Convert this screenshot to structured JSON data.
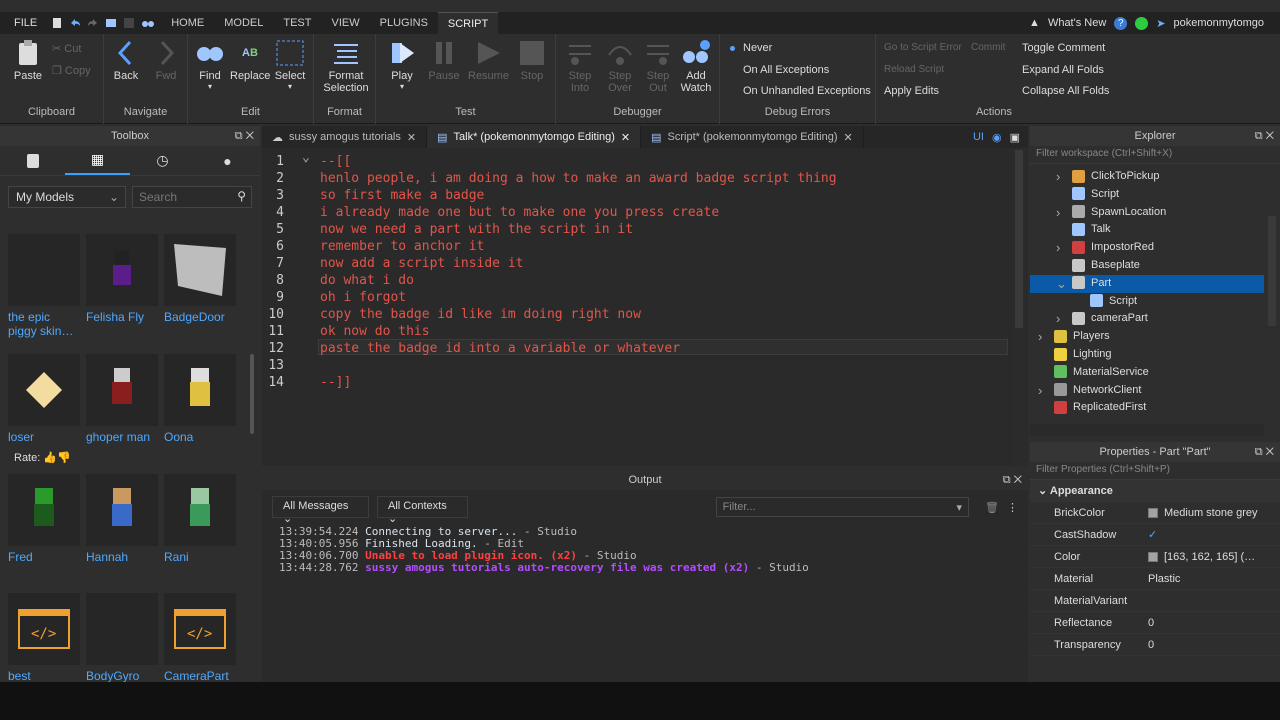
{
  "menubar": {
    "file": "FILE",
    "tabs": [
      "HOME",
      "MODEL",
      "TEST",
      "VIEW",
      "PLUGINS",
      "SCRIPT"
    ],
    "active_tab": "SCRIPT",
    "whats_new": "What's New",
    "username": "pokemonmytomgo"
  },
  "ribbon": {
    "clipboard": {
      "label": "Clipboard",
      "paste": "Paste",
      "cut": "Cut",
      "copy": "Copy"
    },
    "navigate": {
      "label": "Navigate",
      "back": "Back",
      "fwd": "Fwd"
    },
    "edit": {
      "label": "Edit",
      "find": "Find",
      "replace": "Replace",
      "select": "Select"
    },
    "format": {
      "label": "Format",
      "format_selection": "Format Selection"
    },
    "test": {
      "label": "Test",
      "play": "Play",
      "pause": "Pause",
      "resume": "Resume",
      "stop": "Stop"
    },
    "debugger": {
      "label": "Debugger",
      "step_into": "Step Into",
      "step_over": "Step Over",
      "step_out": "Step Out",
      "add_watch": "Add Watch"
    },
    "debug_errors": {
      "label": "Debug Errors",
      "never": "Never",
      "all": "On All Exceptions",
      "unhandled": "On Unhandled Exceptions"
    },
    "actions": {
      "label": "Actions",
      "go_to_error": "Go to Script Error",
      "commit": "Commit",
      "reload": "Reload Script",
      "apply": "Apply Edits",
      "toggle_comment": "Toggle Comment",
      "expand": "Expand All Folds",
      "collapse": "Collapse All Folds"
    }
  },
  "toolbox": {
    "title": "Toolbox",
    "dropdown": "My Models",
    "search_placeholder": "Search",
    "rate_label": "Rate:",
    "items": [
      "the epic piggy skin…",
      "Felisha Fly",
      "BadgeDoor",
      "loser",
      "ghoper man",
      "Oona",
      "Fred",
      "Hannah",
      "Rani",
      "best",
      "BodyGyro",
      "CameraPart"
    ]
  },
  "editor": {
    "tabs": [
      "sussy amogus tutorials",
      "Talk* (pokemonmytomgo Editing)",
      "Script* (pokemonmytomgo Editing)"
    ],
    "ui_label": "UI",
    "lines": [
      "--[[",
      "henlo people, i am doing a how to make an award badge script thing",
      "so first make a badge",
      "i already made one but to make one you press create",
      "now we need a part with the script in it",
      "remember to anchor it",
      "now add a script inside it",
      "do what i do",
      "oh i forgot",
      "copy the badge id like im doing right now",
      "ok now do this",
      "paste the badge id into a variable or whatever",
      "",
      "--]]"
    ],
    "current_line": 12
  },
  "output": {
    "title": "Output",
    "all_messages": "All Messages",
    "all_contexts": "All Contexts",
    "filter_placeholder": "Filter...",
    "logs": [
      {
        "time": "13:39:54.224",
        "msg": "Connecting to server...",
        "ctx": "  -  Studio",
        "color": "#d6e4f0"
      },
      {
        "time": "13:40:05.956",
        "msg": "Finished Loading.",
        "ctx": "  -  Edit",
        "color": "#d6e4f0"
      },
      {
        "time": "13:40:06.700",
        "msg": "Unable to load plugin icon. (x2)",
        "ctx": "  -  Studio",
        "color": "#ff4040"
      },
      {
        "time": "13:44:28.762",
        "msg": "sussy amogus tutorials auto-recovery file was created (x2)",
        "ctx": "  -  Studio",
        "color": "#b44cff"
      }
    ]
  },
  "explorer": {
    "title": "Explorer",
    "filter": "Filter workspace (Ctrl+Shift+X)",
    "nodes": [
      {
        "label": "ClickToPickup",
        "indent": 2,
        "arrow": "right",
        "color": "#e0a040"
      },
      {
        "label": "Script",
        "indent": 2,
        "arrow": "",
        "color": "#9fc6ff"
      },
      {
        "label": "SpawnLocation",
        "indent": 2,
        "arrow": "right",
        "color": "#aaaaaa"
      },
      {
        "label": "Talk",
        "indent": 2,
        "arrow": "",
        "color": "#9fc6ff"
      },
      {
        "label": "ImpostorRed",
        "indent": 2,
        "arrow": "right",
        "color": "#d04040"
      },
      {
        "label": "Baseplate",
        "indent": 2,
        "arrow": "",
        "color": "#c8c8c8"
      },
      {
        "label": "Part",
        "indent": 2,
        "arrow": "down",
        "color": "#c8c8c8",
        "selected": true
      },
      {
        "label": "Script",
        "indent": 3,
        "arrow": "",
        "color": "#9fc6ff"
      },
      {
        "label": "cameraPart",
        "indent": 2,
        "arrow": "right",
        "color": "#c8c8c8"
      },
      {
        "label": "Players",
        "indent": 1,
        "arrow": "right",
        "color": "#e0c040"
      },
      {
        "label": "Lighting",
        "indent": 1,
        "arrow": "",
        "color": "#f0d040"
      },
      {
        "label": "MaterialService",
        "indent": 1,
        "arrow": "",
        "color": "#60c060"
      },
      {
        "label": "NetworkClient",
        "indent": 1,
        "arrow": "right",
        "color": "#999999"
      },
      {
        "label": "ReplicatedFirst",
        "indent": 1,
        "arrow": "",
        "color": "#d04040"
      }
    ]
  },
  "properties": {
    "title": "Properties - Part \"Part\"",
    "filter": "Filter Properties (Ctrl+Shift+P)",
    "section": "Appearance",
    "rows": [
      {
        "k": "BrickColor",
        "v": "Medium stone grey",
        "swatch": "#a3a2a5"
      },
      {
        "k": "CastShadow",
        "v": "✓",
        "swatch": ""
      },
      {
        "k": "Color",
        "v": "[163, 162, 165] (…",
        "swatch": "#a3a2a5"
      },
      {
        "k": "Material",
        "v": "Plastic",
        "swatch": ""
      },
      {
        "k": "MaterialVariant",
        "v": "",
        "swatch": ""
      },
      {
        "k": "Reflectance",
        "v": "0",
        "swatch": ""
      },
      {
        "k": "Transparency",
        "v": "0",
        "swatch": ""
      }
    ]
  }
}
